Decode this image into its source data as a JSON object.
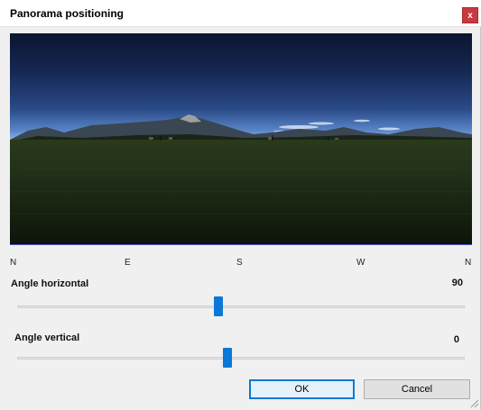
{
  "window": {
    "title": "Panorama positioning",
    "close_label": "x"
  },
  "compass": {
    "n_left": "N",
    "e": "E",
    "s": "S",
    "w": "W",
    "n_right": "N"
  },
  "angle_horizontal": {
    "label": "Angle horizontal",
    "value": "90",
    "slider_fraction": 0.45
  },
  "angle_vertical": {
    "label": "Angle vertical",
    "value": "0",
    "slider_fraction": 0.47
  },
  "buttons": {
    "ok_label": "OK",
    "cancel_label": "Cancel"
  },
  "colors": {
    "accent": "#0a78d7",
    "close_button": "#c8383e"
  },
  "icons": {
    "close": "close-icon",
    "resize": "resize-grip-icon"
  }
}
